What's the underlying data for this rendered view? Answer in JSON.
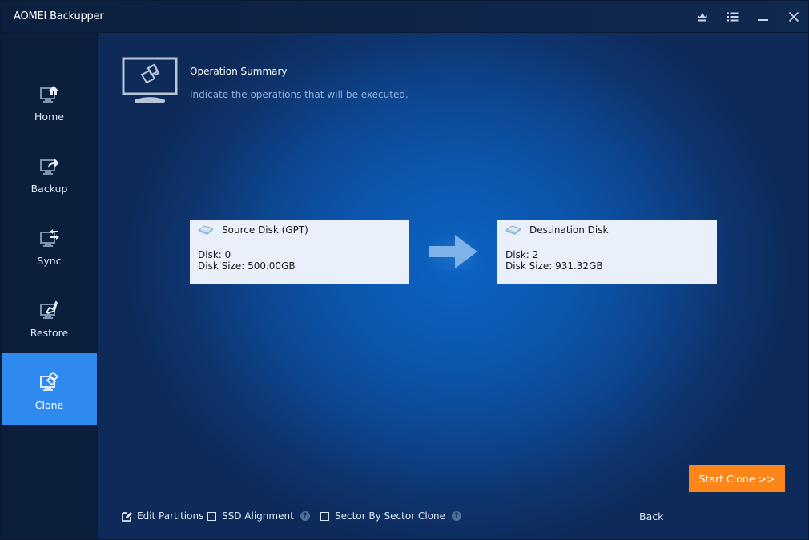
{
  "app": {
    "title": "AOMEI Backupper"
  },
  "titlebar": {
    "buttons": [
      {
        "name": "upgrade",
        "icon": "crown-icon"
      },
      {
        "name": "menu",
        "icon": "list-menu-icon"
      },
      {
        "name": "minimize",
        "icon": "minimize-icon"
      },
      {
        "name": "close",
        "icon": "close-icon"
      }
    ]
  },
  "sidebar": {
    "items": [
      {
        "label": "Home",
        "icon": "home-icon",
        "active": false
      },
      {
        "label": "Backup",
        "icon": "backup-icon",
        "active": false
      },
      {
        "label": "Sync",
        "icon": "sync-icon",
        "active": false
      },
      {
        "label": "Restore",
        "icon": "restore-icon",
        "active": false
      },
      {
        "label": "Clone",
        "icon": "clone-icon",
        "active": true
      }
    ]
  },
  "summary": {
    "title": "Operation Summary",
    "subtitle": "Indicate the operations that will be executed."
  },
  "source": {
    "title": "Source Disk (GPT)",
    "disk": "Disk: 0",
    "size": "Disk Size: 500.00GB"
  },
  "destination": {
    "title": "Destination Disk",
    "disk": "Disk: 2",
    "size": "Disk Size: 931.32GB"
  },
  "options": {
    "edit_partitions": {
      "label": "Edit Partitions",
      "checked": true
    },
    "ssd_alignment": {
      "label": "SSD Alignment",
      "checked": false
    },
    "sector_by_sector": {
      "label": "Sector By Sector Clone",
      "checked": false
    },
    "help_glyph": "?"
  },
  "actions": {
    "back": "Back",
    "start": "Start Clone >>"
  },
  "colors": {
    "accent": "#2f8af0",
    "start_button": "#fd861b",
    "card_bg": "#e9f0fa"
  }
}
